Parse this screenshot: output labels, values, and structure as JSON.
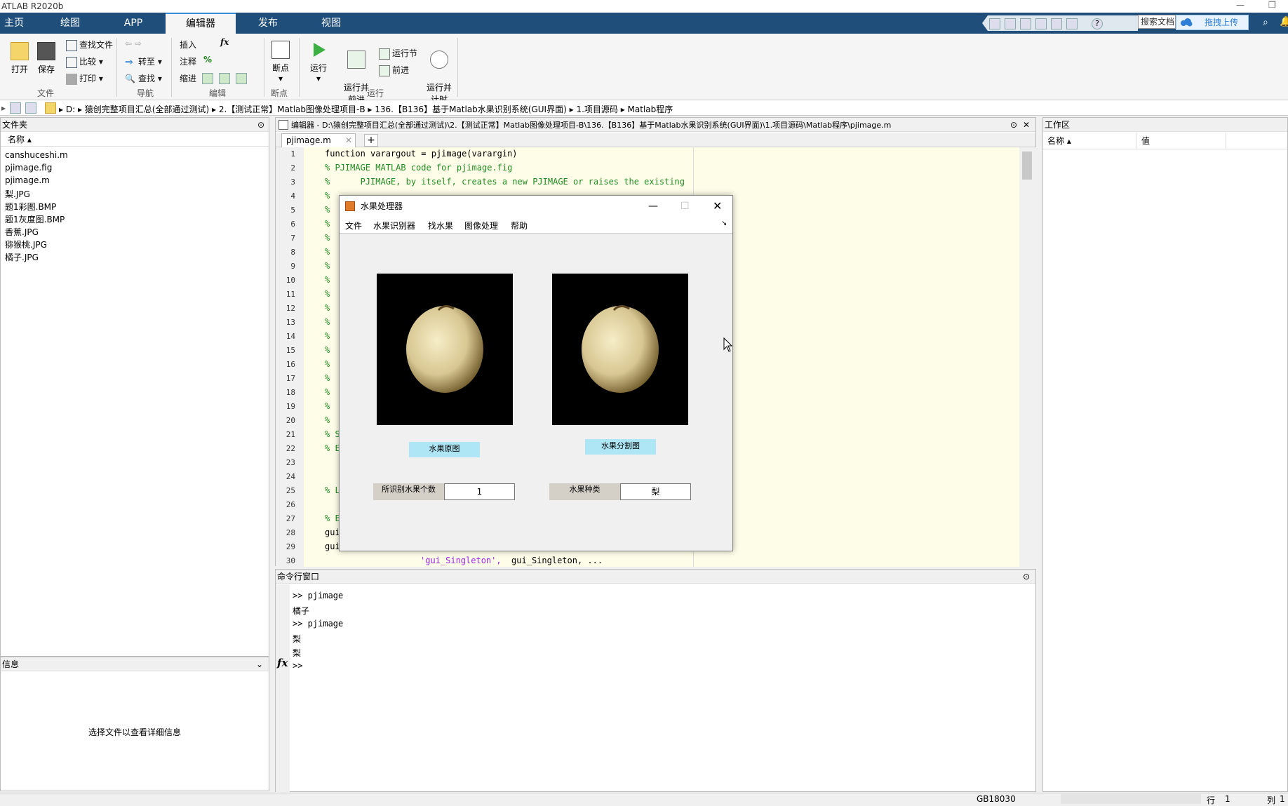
{
  "window": {
    "title": "ATLAB R2020b"
  },
  "tabs": [
    {
      "label": "主页"
    },
    {
      "label": "绘图"
    },
    {
      "label": "APP"
    },
    {
      "label": "编辑器"
    },
    {
      "label": "发布"
    },
    {
      "label": "视图"
    }
  ],
  "quick": {
    "search_placeholder": "搜索文档",
    "baidu_label": "拖拽上传"
  },
  "ribbon": {
    "file": {
      "open": "打开",
      "save": "保存",
      "find_files": "查找文件",
      "compare": "比较",
      "print": "打印",
      "group": "文件"
    },
    "nav": {
      "goto": "转至",
      "find": "查找",
      "group": "导航"
    },
    "edit": {
      "insert": "插入",
      "fx": "fx",
      "comment": "注释",
      "indent": "缩进",
      "pct": "%",
      "group": "编辑"
    },
    "breakpoints": {
      "label": "断点",
      "group": "断点"
    },
    "run": {
      "run": "运行",
      "run_advance": "运行并\n前进",
      "run_section": "运行节",
      "advance": "前进",
      "run_time": "运行并\n计时",
      "group": "运行"
    }
  },
  "breadcrumb": [
    "D:",
    "猿创完整项目汇总(全部通过测试)",
    "2.【测试正常】Matlab图像处理项目-B",
    "136.【B136】基于Matlab水果识别系统(GUI界面)",
    "1.项目源码",
    "Matlab程序"
  ],
  "files_panel": {
    "title": "文件夹",
    "col_name": "名称",
    "files": [
      "canshuceshi.m",
      "pjimage.fig",
      "pjimage.m",
      "梨.JPG",
      "题1彩图.BMP",
      "题1灰度图.BMP",
      "香蕉.JPG",
      "猕猴桃.JPG",
      "橘子.JPG"
    ]
  },
  "details_panel": {
    "title": "信息",
    "message": "选择文件以查看详细信息"
  },
  "editor": {
    "title": "编辑器 - D:\\猿创完整项目汇总(全部通过测试)\\2.【测试正常】Matlab图像处理项目-B\\136.【B136】基于Matlab水果识别系统(GUI界面)\\1.项目源码\\Matlab程序\\pjimage.m",
    "tab": "pjimage.m",
    "add_tab": "+",
    "line_numbers": [
      "1",
      "2",
      "3",
      "4",
      "5",
      "6",
      "7",
      "8",
      "9",
      "10",
      "11",
      "12",
      "13",
      "14",
      "15",
      "16",
      "17",
      "18",
      "19",
      "20",
      "21",
      "22",
      "23",
      "24",
      "25",
      "26",
      "27",
      "28",
      "29",
      "30"
    ],
    "lines": {
      "l1": "function varargout = pjimage(varargin)",
      "l2": "% PJIMAGE MATLAB code for pjimage.fig",
      "l3": "%      PJIMAGE, by itself, creates a new PJIMAGE or raises the existing",
      "l21": "% S",
      "l22": "% E",
      "l25": "% L",
      "l27": "% E",
      "l28": "gui",
      "l29": "gui",
      "l30_str": "'gui_Singleton',",
      "l30_rest": "  gui_Singleton, ..."
    },
    "comment_marker": "%"
  },
  "figure": {
    "title": "水果处理器",
    "menu": [
      "文件",
      "水果识别器",
      "找水果",
      "图像处理",
      "帮助"
    ],
    "btn_original": "水果原图",
    "btn_segment": "水果分割图",
    "label_count": "所识别水果个数",
    "value_count": "1",
    "label_kind": "水果种类",
    "value_kind": "梨"
  },
  "command_window": {
    "title": "命令行窗口",
    "lines": [
      ">> pjimage",
      "橘子",
      ">> pjimage",
      "梨",
      "梨"
    ],
    "prompt": ">>",
    "fx": "fx"
  },
  "workspace": {
    "title": "工作区",
    "col_name": "名称",
    "col_value": "值"
  },
  "status": {
    "encoding": "GB18030",
    "row_label": "行",
    "row": "1",
    "col_label": "列",
    "col": "1"
  }
}
